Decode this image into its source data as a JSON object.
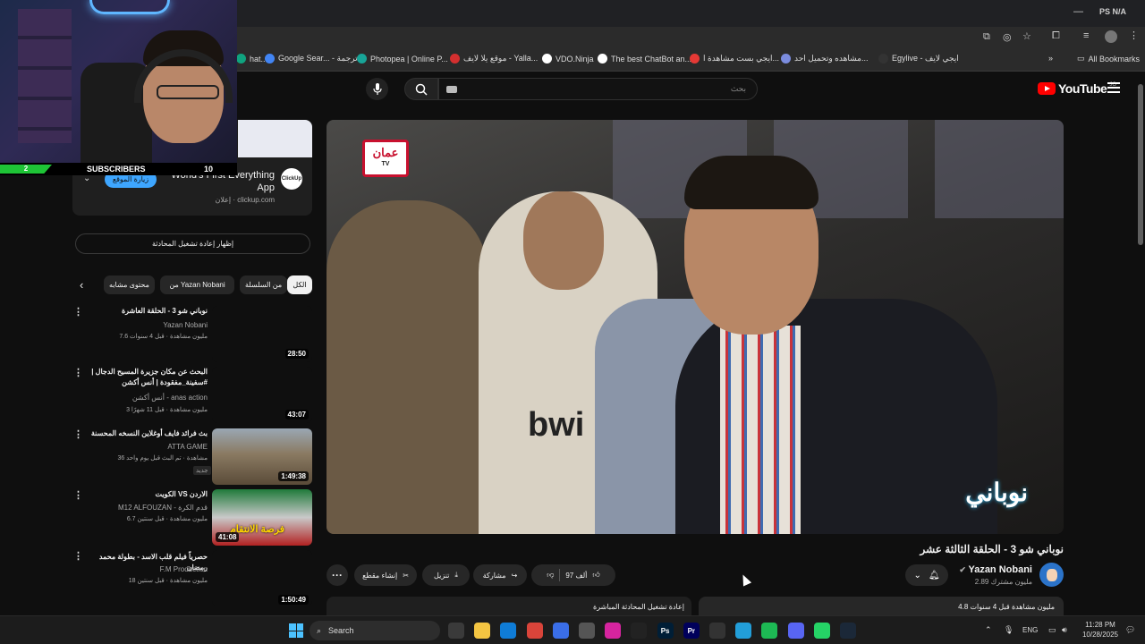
{
  "browser": {
    "window_title_right": "PS N/A",
    "bookmarks": [
      {
        "label": "hat...",
        "color": "#10a37f"
      },
      {
        "label": "Google Sear... - ترجمة",
        "color": "#4285f4"
      },
      {
        "label": "Photopea | Online P...",
        "color": "#18a497"
      },
      {
        "label": "موقع يلا لايف - Yalla...",
        "color": "#d32f2f"
      },
      {
        "label": "VDO.Ninja",
        "color": "#ffffff"
      },
      {
        "label": "The best ChatBot an...",
        "color": "#ffffff"
      },
      {
        "label": "ايجي بست مشاهدة ا...",
        "color": "#e53935"
      },
      {
        "label": "مشاهده وتحميل احد...",
        "color": "#7b8cde"
      },
      {
        "label": "Egylive - ايجي لايف",
        "color": "#333333"
      }
    ],
    "all_bookmarks_label": "All Bookmarks"
  },
  "stream_overlay": {
    "goal_progress_label": "2",
    "subscribers_label": "SUBSCRIBERS",
    "subscribers_count": "10"
  },
  "youtube": {
    "logo_text": "YouTube",
    "logo_country": "JO",
    "search_placeholder": "بحث",
    "ad": {
      "title": "World's First Everything App",
      "meta": "إعلان · clickup.com",
      "visit_label": "زيارة الموقع",
      "logo_text": "ClickUp"
    },
    "show_chat_replay": "إظهار إعادة تشغيل المحادثة",
    "chips": [
      {
        "label": "الكل",
        "active": true
      },
      {
        "label": "من السلسلة",
        "active": false
      },
      {
        "label": "من Yazan Nobani",
        "active": false
      },
      {
        "label": "محتوى مشابه",
        "active": false
      }
    ],
    "recommendations": [
      {
        "title": "نوباني شو 3 - الحلقة العاشرة",
        "channel": "Yazan Nobani",
        "stats": "7.6 مليون مشاهدة · قبل 4 سنوات",
        "duration": "28:50",
        "thumb_color": "#2e2e2e"
      },
      {
        "title": "البحث عن مكان جزيرة المسيح الدجال | #سفينة_مفقودة | أنس أكشن",
        "channel": "أنس أكشن - anas action",
        "stats": "3 مليون مشاهدة · قبل 11 شهرًا",
        "duration": "43:07",
        "thumb_color": "#2a2a2a"
      },
      {
        "title": "بث فرائد فايف أوغلاين النسخه المحسنة",
        "channel": "ATTA GAME",
        "stats": "36 مشاهدة · تم البث قبل يوم واحد",
        "badge": "جديد",
        "duration": "1:49:38",
        "thumb_color": "#6b5d4d"
      },
      {
        "title": "الكويت VS الاردن",
        "channel": "M12 ALFOUZAN - قدم الكرة",
        "stats": "6.7 مليون مشاهدة · قبل سنتين",
        "duration": "41:08",
        "thumb_color": "#1e7a3a",
        "thumb_text": "فرصة الانتقام"
      },
      {
        "title": "حصرياً فيلم قلب الاسد - بطولة محمد رمضان",
        "channel": "F.M Production",
        "stats": "18 مليون مشاهدة · قبل سنتين",
        "duration": "1:50:49",
        "thumb_color": "#1b1b1b"
      }
    ],
    "video": {
      "title": "نوباني شو 3 - الحلقة الثالثة عشر",
      "channel_name": "Yazan Nobani",
      "channel_subs": "2.89 مليون مشترك",
      "broadcaster_logo": "عمان",
      "broadcaster_sub": "TV",
      "show_logo": "نوباني",
      "likes": "97 ألف",
      "share_label": "مشاركة",
      "download_label": "تنزيل",
      "clip_label": "إنشاء مقطع",
      "description_header": "4.8 مليون مشاهدة  قبل 4 سنوات",
      "livechat_header": "إعادة تشغيل المحادثة المباشرة"
    }
  },
  "taskbar": {
    "search_label": "Search",
    "language": "ENG",
    "time": "11:28 PM",
    "date": "10/28/2025",
    "apps": [
      {
        "name": "task-view",
        "color": "#3a3a3a",
        "text": ""
      },
      {
        "name": "file-explorer",
        "color": "#f4c542",
        "text": ""
      },
      {
        "name": "edge",
        "color": "#0f7cd6",
        "text": ""
      },
      {
        "name": "chrome",
        "color": "#d9443a",
        "text": ""
      },
      {
        "name": "store",
        "color": "#3a6ee8",
        "text": ""
      },
      {
        "name": "obs",
        "color": "#555555",
        "text": ""
      },
      {
        "name": "instagram",
        "color": "#d6249f",
        "text": ""
      },
      {
        "name": "capcut",
        "color": "#222222",
        "text": ""
      },
      {
        "name": "photoshop",
        "color": "#001e36",
        "text": "Ps"
      },
      {
        "name": "premiere",
        "color": "#00005b",
        "text": "Pr"
      },
      {
        "name": "discord-alt",
        "color": "#333333",
        "text": ""
      },
      {
        "name": "telegram",
        "color": "#229ed9",
        "text": ""
      },
      {
        "name": "spotify",
        "color": "#1db954",
        "text": ""
      },
      {
        "name": "discord",
        "color": "#5865f2",
        "text": ""
      },
      {
        "name": "whatsapp",
        "color": "#25d366",
        "text": ""
      },
      {
        "name": "steam",
        "color": "#1b2838",
        "text": ""
      }
    ]
  }
}
